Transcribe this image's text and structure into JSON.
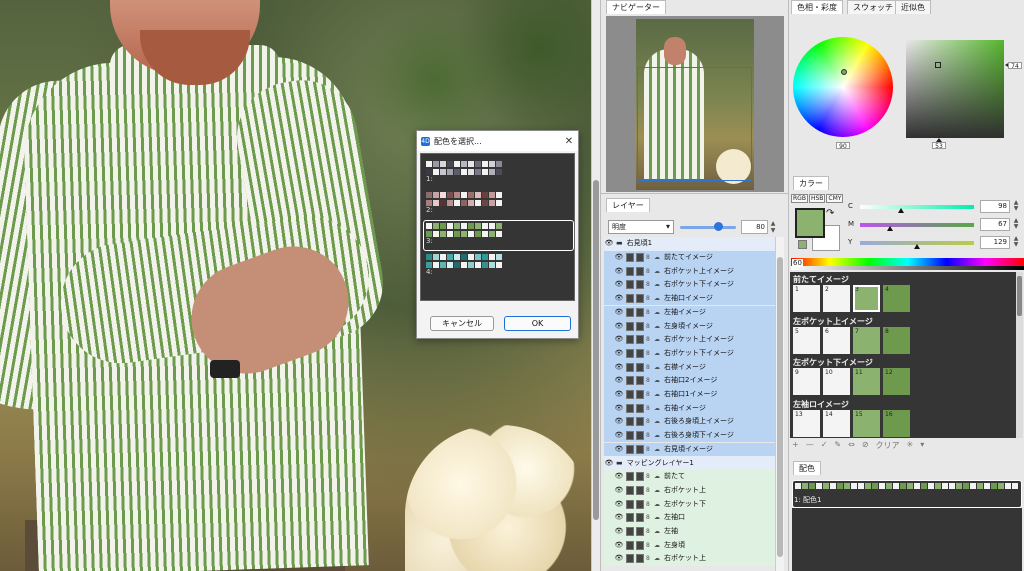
{
  "dialog": {
    "title": "配色を選択...",
    "items": [
      {
        "num": "1:",
        "colors": [
          "#f3f3f3",
          "#9a9aa6",
          "#d6d6dc",
          "#4a4a55",
          "#f3f3f3",
          "#b7b7c2",
          "#e6e6ea",
          "#6b6b78",
          "#f3f3f3",
          "#d0d0d8",
          "#8a8a96",
          "#3a3a46",
          "#f3f3f3",
          "#c6c6ce",
          "#a4a4b0",
          "#5e5e6a",
          "#f3f3f3",
          "#e2e2e8",
          "#7a7a86",
          "#f3f3f3",
          "#b0b0bb",
          "#4c4c58"
        ]
      },
      {
        "num": "2:",
        "colors": [
          "#8c6b6b",
          "#c7a4a4",
          "#f0dede",
          "#7a4f4f",
          "#b08787",
          "#f3f3f3",
          "#9c6f6f",
          "#dcbcbc",
          "#6a3f3f",
          "#c29a9a",
          "#f3f3f3",
          "#a87d7d",
          "#e6caca",
          "#5a3232",
          "#bb9292",
          "#f3f3f3",
          "#8f6262",
          "#d2b0b0",
          "#f3f3f3",
          "#704444",
          "#c9a3a3",
          "#f3f3f3"
        ]
      },
      {
        "num": "3:",
        "colors": [
          "#f3f3f3",
          "#8cb270",
          "#6e9a4e",
          "#f3f3f3",
          "#8cb270",
          "#f3f3f3",
          "#6e9a4e",
          "#8cb270",
          "#f3f3f3",
          "#f3f3f3",
          "#8cb270",
          "#6e9a4e",
          "#f3f3f3",
          "#8cb270",
          "#f3f3f3",
          "#6e9a4e",
          "#8cb270",
          "#f3f3f3",
          "#6e9a4e",
          "#f3f3f3",
          "#8cb270",
          "#f3f3f3"
        ]
      },
      {
        "num": "4:",
        "colors": [
          "#2a8c8c",
          "#9fd6d6",
          "#f3f3f3",
          "#4aa8a8",
          "#c9ecec",
          "#1e6e6e",
          "#f3f3f3",
          "#7cc4c4",
          "#2f9a9a",
          "#f3f3f3",
          "#b4e2e2",
          "#3e9e9e",
          "#f3f3f3",
          "#5eb6b6",
          "#d6f2f2",
          "#246c6c",
          "#f3f3f3",
          "#8fcccc",
          "#f3f3f3",
          "#3a8f8f",
          "#a8dede",
          "#f3f3f3"
        ]
      }
    ],
    "cancel": "キャンセル",
    "ok": "OK"
  },
  "navigator": {
    "tab": "ナビゲーター"
  },
  "color_panel": {
    "tabs": [
      "色相・彩度",
      "スウォッチ",
      "近似色"
    ],
    "hue_value": "90",
    "sat_value": "53",
    "bright_value": "74"
  },
  "mixer": {
    "tab": "カラー",
    "modes": [
      "RGB",
      "HSB",
      "CMY"
    ],
    "sliders": [
      {
        "label": "C",
        "value": "98",
        "pos": 0.36,
        "gradient": "linear-gradient(90deg,#fff,#0ea)"
      },
      {
        "label": "M",
        "value": "67",
        "pos": 0.26,
        "gradient": "linear-gradient(90deg,#b5e,#5a4)"
      },
      {
        "label": "Y",
        "value": "129",
        "pos": 0.5,
        "gradient": "linear-gradient(90deg,#9ad,#bc4)"
      }
    ],
    "palette_index": "60",
    "groups": [
      {
        "title": "前たてイメージ",
        "cells": [
          {
            "n": "1",
            "c": ""
          },
          {
            "n": "2",
            "c": ""
          },
          {
            "n": "3",
            "c": "g",
            "sel": true
          },
          {
            "n": "4",
            "c": "d"
          }
        ]
      },
      {
        "title": "左ポケット上イメージ",
        "cells": [
          {
            "n": "5",
            "c": ""
          },
          {
            "n": "6",
            "c": ""
          },
          {
            "n": "7",
            "c": "g"
          },
          {
            "n": "8",
            "c": "d"
          }
        ]
      },
      {
        "title": "左ポケット下イメージ",
        "cells": [
          {
            "n": "9",
            "c": ""
          },
          {
            "n": "10",
            "c": ""
          },
          {
            "n": "11",
            "c": "g"
          },
          {
            "n": "12",
            "c": "d"
          }
        ]
      },
      {
        "title": "左袖ロイメージ",
        "cells": [
          {
            "n": "13",
            "c": ""
          },
          {
            "n": "14",
            "c": ""
          },
          {
            "n": "15",
            "c": "g"
          },
          {
            "n": "16",
            "c": "d"
          }
        ]
      }
    ],
    "tools": [
      "+",
      "—",
      "✓",
      "✎",
      "⇔",
      "⊘",
      "クリア",
      "✳",
      "▾"
    ]
  },
  "palette_panel": {
    "tab": "配色",
    "label": "1: 配色1"
  },
  "layers": {
    "tab": "レイヤー",
    "blend": "明度",
    "opacity": "80",
    "opacity_fraction": 0.68,
    "rows": [
      {
        "name": "右見頃1",
        "type": "grp"
      },
      {
        "name": "前たてイメージ",
        "type": "sel"
      },
      {
        "name": "右ポケット上イメージ",
        "type": "sel"
      },
      {
        "name": "右ポケット下イメージ",
        "type": "sel"
      },
      {
        "name": "左袖口イメージ",
        "type": "sel"
      },
      {
        "name": "左袖イメージ",
        "type": "sel"
      },
      {
        "name": "左身頃イメージ",
        "type": "sel"
      },
      {
        "name": "右ポケット上イメージ",
        "type": "sel"
      },
      {
        "name": "右ポケット下イメージ",
        "type": "sel"
      },
      {
        "name": "右襟イメージ",
        "type": "sel"
      },
      {
        "name": "右袖口2イメージ",
        "type": "sel"
      },
      {
        "name": "右袖口1イメージ",
        "type": "sel"
      },
      {
        "name": "右袖イメージ",
        "type": "sel"
      },
      {
        "name": "右後ろ身頃上イメージ",
        "type": "sel"
      },
      {
        "name": "右後ろ身頃下イメージ",
        "type": "sel"
      },
      {
        "name": "右見頃イメージ",
        "type": "sel"
      },
      {
        "name": "マッピングレイヤー1",
        "type": "grp2"
      },
      {
        "name": "前たて",
        "type": "green"
      },
      {
        "name": "右ポケット上",
        "type": "green"
      },
      {
        "name": "左ポケット下",
        "type": "green"
      },
      {
        "name": "左袖口",
        "type": "green"
      },
      {
        "name": "左袖",
        "type": "green"
      },
      {
        "name": "左身頃",
        "type": "green"
      },
      {
        "name": "右ポケット上",
        "type": "green"
      }
    ]
  }
}
